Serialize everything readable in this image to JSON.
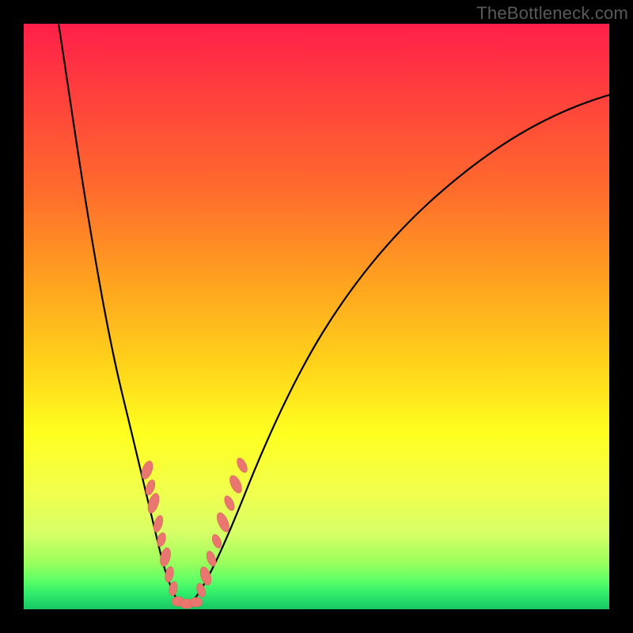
{
  "watermark": {
    "text": "TheBottleneck.com"
  },
  "chart_data": {
    "type": "line",
    "title": "",
    "xlabel": "",
    "ylabel": "",
    "xlim": [
      0,
      100
    ],
    "ylim": [
      0,
      100
    ],
    "series": [
      {
        "name": "bottleneck-curve",
        "x": [
          6,
          8,
          10,
          12,
          14,
          16,
          18,
          20,
          22,
          23.5,
          25,
          26.5,
          28,
          30,
          33,
          36,
          40,
          45,
          50,
          56,
          63,
          71,
          80,
          90,
          100
        ],
        "values": [
          100,
          88,
          76,
          65,
          55,
          46,
          37,
          28,
          18,
          10,
          4,
          0.5,
          1.5,
          5,
          12,
          21,
          31,
          41,
          50,
          58,
          65,
          72,
          78,
          83,
          87
        ]
      }
    ],
    "annotations": [
      {
        "name": "left-bead-cluster",
        "shape": "beads",
        "side": "left",
        "approx_x": 21.5,
        "approx_y_range": [
          6,
          24
        ]
      },
      {
        "name": "right-bead-cluster",
        "shape": "beads",
        "side": "right",
        "approx_x": 30.5,
        "approx_y_range": [
          5,
          24
        ]
      },
      {
        "name": "bottom-bead-cluster",
        "shape": "beads",
        "side": "bottom",
        "approx_x_range": [
          24,
          28
        ],
        "approx_y": 1
      }
    ],
    "background_gradient": {
      "direction": "vertical",
      "stops": [
        {
          "pos": 0.0,
          "color": "#ff1f4a"
        },
        {
          "pos": 0.5,
          "color": "#ffb21f"
        },
        {
          "pos": 0.72,
          "color": "#ffff20"
        },
        {
          "pos": 0.95,
          "color": "#5fff66"
        },
        {
          "pos": 1.0,
          "color": "#17c763"
        }
      ]
    }
  }
}
